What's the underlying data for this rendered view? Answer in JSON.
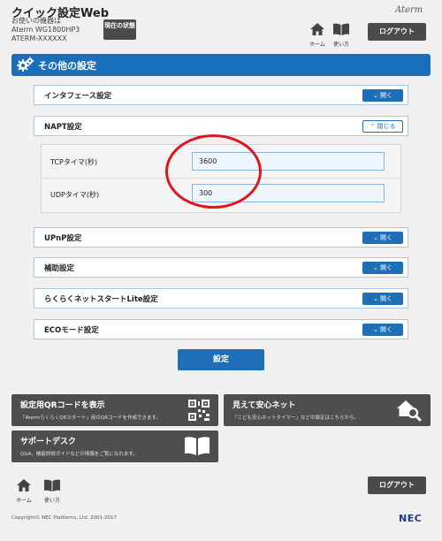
{
  "header": {
    "app_title": "クイック設定Web",
    "model_caption": "お使いの機器は",
    "model_name": "Aterm WG1800HP3",
    "device_name": "ATERM-XXXXXX",
    "status_button": "現在の状態",
    "home_label": "ホーム",
    "help_label": "使い方",
    "brand": "Aterm",
    "logout": "ログアウト"
  },
  "section": {
    "title": "その他の設定"
  },
  "panels": {
    "interface": {
      "title": "インタフェース設定",
      "toggle": "開く"
    },
    "napt": {
      "title": "NAPT設定",
      "toggle": "閉じる"
    },
    "upnp": {
      "title": "UPnP設定",
      "toggle": "開く"
    },
    "aux": {
      "title": "補助設定",
      "toggle": "開く"
    },
    "rakuraku": {
      "title": "らくらくネットスタートLite設定",
      "toggle": "開く"
    },
    "eco": {
      "title": "ECOモード設定",
      "toggle": "開く"
    }
  },
  "napt_fields": {
    "tcp_label": "TCPタイマ(秒)",
    "tcp_value": "3600",
    "udp_label": "UDPタイマ(秒)",
    "udp_value": "300"
  },
  "submit": "設定",
  "cards": {
    "qr": {
      "title": "設定用QRコードを表示",
      "desc": "「AtermらくらくQRスタート」用のQRコードを作成できます。"
    },
    "safety": {
      "title": "見えて安心ネット",
      "desc": "「こども安心ネットタイマー」などの設定はこちらから。"
    },
    "support": {
      "title": "サポートデスク",
      "desc": "Q&A、機能詳説ガイドなどの情報をご覧になれます。"
    }
  },
  "footer": {
    "home_label": "ホーム",
    "help_label": "使い方",
    "logout": "ログアウト",
    "copyright": "Copyright© NEC Platforms, Ltd. 2001-2017",
    "nec": "NEC"
  },
  "colors": {
    "accent": "#1e6fb8",
    "dark_button": "#4a4a4a",
    "annotation": "#e0161e"
  }
}
